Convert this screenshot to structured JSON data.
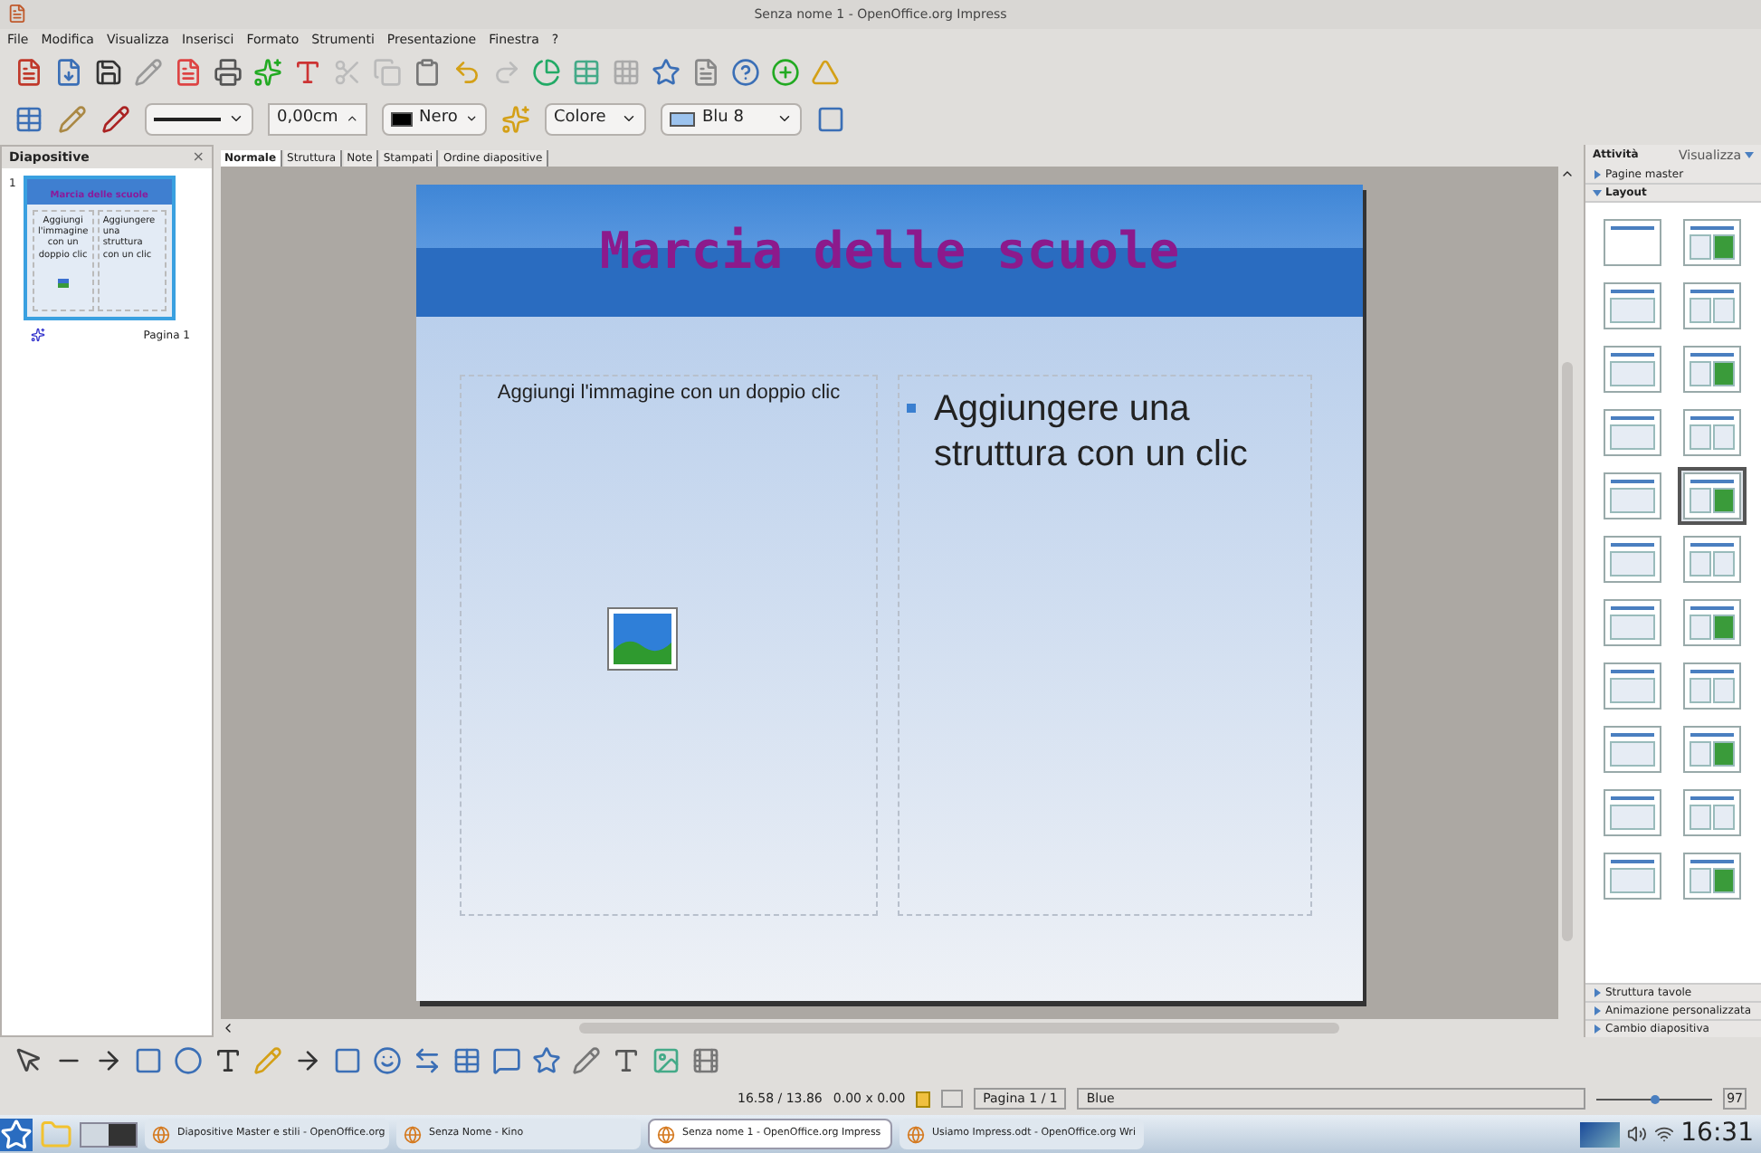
{
  "window": {
    "title": "Senza nome 1 - OpenOffice.org Impress"
  },
  "menu": [
    "File",
    "Modifica",
    "Visualizza",
    "Inserisci",
    "Formato",
    "Strumenti",
    "Presentazione",
    "Finestra",
    "?"
  ],
  "line_toolbar": {
    "width": "0,00cm",
    "line_color": "Nero",
    "fill_type": "Colore",
    "fill_color": "Blu 8"
  },
  "slides_panel": {
    "title": "Diapositive",
    "close": "×",
    "slides": [
      {
        "number": "1",
        "title": "Marcia delle scuole",
        "left_text": "Aggiungi l'immagine con un doppio clic",
        "bullet": "Aggiungere una struttura con un clic",
        "label": "Pagina 1",
        "selected": true
      }
    ]
  },
  "view_tabs": [
    {
      "label": "Normale",
      "selected": true
    },
    {
      "label": "Struttura",
      "selected": false
    },
    {
      "label": "Note",
      "selected": false
    },
    {
      "label": "Stampati",
      "selected": false
    },
    {
      "label": "Ordine diapositive",
      "selected": false
    }
  ],
  "slide": {
    "title": "Marcia delle scuole",
    "image_placeholder": "Aggiungi l'immagine con un doppio clic",
    "outline_placeholder": "Aggiungere una struttura con un clic"
  },
  "tasks_panel": {
    "title": "Attività",
    "view_menu": "Visualizza",
    "sections_top": [
      {
        "label": "Pagine master",
        "expanded": false
      },
      {
        "label": "Layout",
        "expanded": true
      }
    ],
    "layouts": [
      {
        "selected": false
      },
      {
        "selected": false
      },
      {
        "selected": false
      },
      {
        "selected": false
      },
      {
        "selected": false
      },
      {
        "selected": false
      },
      {
        "selected": false
      },
      {
        "selected": false
      },
      {
        "selected": false
      },
      {
        "selected": true
      },
      {
        "selected": false
      },
      {
        "selected": false
      },
      {
        "selected": false
      },
      {
        "selected": false
      },
      {
        "selected": false
      },
      {
        "selected": false
      },
      {
        "selected": false
      },
      {
        "selected": false
      },
      {
        "selected": false
      },
      {
        "selected": false
      },
      {
        "selected": false
      },
      {
        "selected": false
      }
    ],
    "sections_bottom": [
      {
        "label": "Struttura tavole",
        "expanded": false
      },
      {
        "label": "Animazione personalizzata",
        "expanded": false
      },
      {
        "label": "Cambio diapositiva",
        "expanded": false
      }
    ]
  },
  "status_bar": {
    "position": "16.58 / 13.86",
    "size": "0.00 x 0.00",
    "page": "Pagina 1 / 1",
    "design": "Blue",
    "zoom_slider": {
      "level": 0.5
    },
    "zoom": "97"
  },
  "taskbar": {
    "tasks": [
      {
        "label": "Diapositive Master e stili - OpenOffice.org",
        "selected": false
      },
      {
        "label": "Senza Nome - Kino",
        "selected": false
      },
      {
        "label": "Senza nome 1 - OpenOffice.org Impress",
        "selected": true
      },
      {
        "label": "Usiamo Impress.odt - OpenOffice.org Wri",
        "selected": false
      }
    ],
    "clock": "16:31"
  }
}
